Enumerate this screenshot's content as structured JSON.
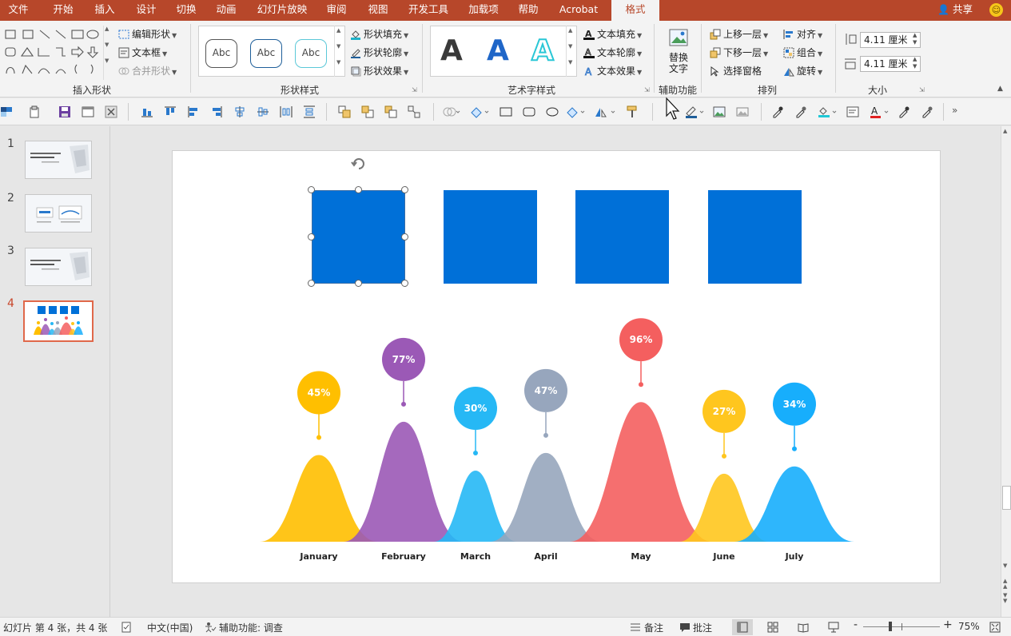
{
  "tabs": [
    {
      "label": "文件"
    },
    {
      "label": "开始"
    },
    {
      "label": "插入"
    },
    {
      "label": "设计"
    },
    {
      "label": "切换"
    },
    {
      "label": "动画"
    },
    {
      "label": "幻灯片放映"
    },
    {
      "label": "审阅"
    },
    {
      "label": "视图"
    },
    {
      "label": "开发工具"
    },
    {
      "label": "加载项"
    },
    {
      "label": "帮助"
    },
    {
      "label": "Acrobat"
    },
    {
      "label": "格式"
    }
  ],
  "share_label": "共享",
  "ribbon": {
    "insert_shapes": {
      "label": "插入形状",
      "edit_shape": "编辑形状",
      "text_box": "文本框",
      "merge_shapes": "合并形状"
    },
    "shape_styles": {
      "label": "形状样式",
      "sample_text": "Abc",
      "fill": "形状填充",
      "outline": "形状轮廓",
      "effects": "形状效果"
    },
    "wordart_styles": {
      "label": "艺术字样式",
      "sample": "A",
      "text_fill": "文本填充",
      "text_outline": "文本轮廓",
      "text_effects": "文本效果"
    },
    "accessibility": {
      "label": "辅助功能",
      "alt_text_line1": "替换",
      "alt_text_line2": "文字"
    },
    "arrange": {
      "label": "排列",
      "bring_forward": "上移一层",
      "send_backward": "下移一层",
      "selection_pane": "选择窗格",
      "align": "对齐",
      "group": "组合",
      "rotate": "旋转"
    },
    "size": {
      "label": "大小",
      "height": "4.11 厘米",
      "width": "4.11 厘米"
    }
  },
  "thumbnails": [
    {
      "number": "1"
    },
    {
      "number": "2"
    },
    {
      "number": "3"
    },
    {
      "number": "4"
    }
  ],
  "chart_data": {
    "type": "area",
    "categories": [
      "January",
      "February",
      "March",
      "April",
      "May",
      "June",
      "July"
    ],
    "series": [
      {
        "values": [
          45,
          77,
          30,
          47,
          96,
          27,
          34
        ]
      }
    ],
    "labels": [
      "45%",
      "77%",
      "30%",
      "47%",
      "96%",
      "27%",
      "34%"
    ],
    "colors": [
      "#ffbf00",
      "#9b59b6",
      "#26b8f5",
      "#97a6bd",
      "#f45f5f",
      "#ffc61e",
      "#17aefc"
    ]
  },
  "squares_color": "#0070d8",
  "status": {
    "slide_info": "幻灯片 第 4 张，共 4 张",
    "language": "中文(中国)",
    "accessibility": "辅助功能: 调查",
    "notes": "备注",
    "comments": "批注",
    "zoom_minus": "-",
    "zoom_plus": "+",
    "zoom": "75%"
  }
}
